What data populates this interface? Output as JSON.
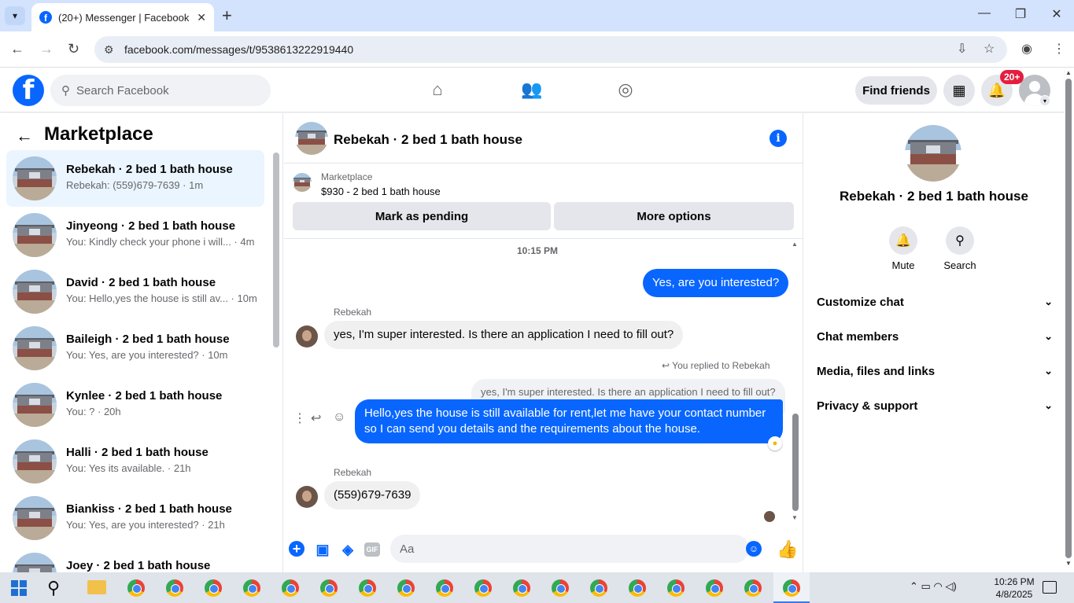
{
  "browser": {
    "tab_title": "(20+) Messenger | Facebook",
    "url": "facebook.com/messages/t/9538613222919440"
  },
  "fb": {
    "search_placeholder": "Search Facebook",
    "find_friends": "Find friends",
    "notif_count": "20+"
  },
  "left": {
    "title": "Marketplace",
    "conversations": [
      {
        "name": "Rebekah · 2 bed 1 bath house",
        "snippet": "Rebekah: (559)679-7639 · 1m",
        "active": true
      },
      {
        "name": "Jinyeong · 2 bed 1 bath house",
        "snippet": "You: Kindly check your phone i will... · 4m"
      },
      {
        "name": "David · 2 bed 1 bath house",
        "snippet": "You: Hello,yes the house is still av... · 10m"
      },
      {
        "name": "Baileigh · 2 bed 1 bath house",
        "snippet": "You: Yes, are you interested? · 10m"
      },
      {
        "name": "Kynlee · 2 bed 1 bath house",
        "snippet": "You: ? · 20h"
      },
      {
        "name": "Halli · 2 bed 1 bath house",
        "snippet": "You: Yes its available. · 21h"
      },
      {
        "name": "Biankiss · 2 bed 1 bath house",
        "snippet": "You: Yes, are you interested? · 21h"
      },
      {
        "name": "Joey · 2 bed 1 bath house",
        "snippet": ""
      }
    ]
  },
  "chat": {
    "title": "Rebekah · 2 bed 1 bath house",
    "banner_label": "Marketplace",
    "banner_price": "$930 - 2 bed 1 bath house",
    "btn_pending": "Mark as pending",
    "btn_more": "More options",
    "time": "10:15 PM",
    "msg1": "Yes, are you interested?",
    "sender1": "Rebekah",
    "msg2": "yes, I'm super interested. Is there an application I need to fill out?",
    "replied_label": "You replied to Rebekah",
    "quoted": "yes, I'm super interested. Is there an application I need to fill out?",
    "msg3_line1": "Hello,yes the house is still available for rent,let me have your contact number",
    "msg3_line2": "so I can send you details and the requirements about the house.",
    "sender2": "Rebekah",
    "msg4": "(559)679-7639",
    "input_placeholder": "Aa",
    "gif_label": "GIF"
  },
  "right": {
    "name": "Rebekah · 2 bed 1 bath house",
    "mute": "Mute",
    "search": "Search",
    "rows": [
      "Customize chat",
      "Chat members",
      "Media, files and links",
      "Privacy & support"
    ]
  },
  "taskbar": {
    "time": "10:26 PM",
    "date": "4/8/2025"
  }
}
